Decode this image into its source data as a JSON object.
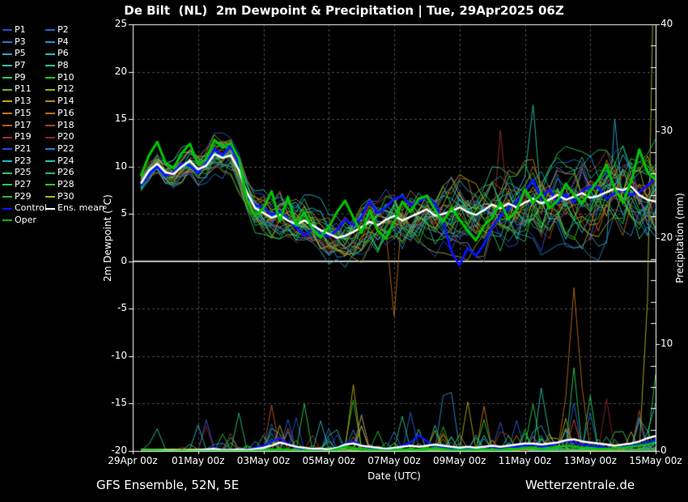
{
  "title": "De Bilt  (NL)  2m Dewpoint & Precipitation | Tue, 29Apr2025 06Z",
  "footer": {
    "left": "GFS Ensemble, 52N, 5E",
    "right": "Wetterzentrale.de"
  },
  "colors": {
    "background": "#000000",
    "grid": "#4d4d4d",
    "axis": "#ffffff",
    "zero_line": "#ffffff"
  },
  "legend": {
    "entries": [
      {
        "label": "P1",
        "color": "#2850d2"
      },
      {
        "label": "P2",
        "color": "#2862d8"
      },
      {
        "label": "P3",
        "color": "#2878d0"
      },
      {
        "label": "P4",
        "color": "#2890cc"
      },
      {
        "label": "P5",
        "color": "#28a8c8"
      },
      {
        "label": "P6",
        "color": "#28bcc0"
      },
      {
        "label": "P7",
        "color": "#28c4a8"
      },
      {
        "label": "P8",
        "color": "#28c888"
      },
      {
        "label": "P9",
        "color": "#28cc60"
      },
      {
        "label": "P10",
        "color": "#20c820"
      },
      {
        "label": "P11",
        "color": "#7ab428"
      },
      {
        "label": "P12",
        "color": "#aca818"
      },
      {
        "label": "P13",
        "color": "#c4a41c"
      },
      {
        "label": "P14",
        "color": "#c08618"
      },
      {
        "label": "P15",
        "color": "#c8781c"
      },
      {
        "label": "P16",
        "color": "#b86a14"
      },
      {
        "label": "P17",
        "color": "#c45420"
      },
      {
        "label": "P18",
        "color": "#a84428"
      },
      {
        "label": "P19",
        "color": "#9c3028"
      },
      {
        "label": "P20",
        "color": "#8c2424"
      },
      {
        "label": "P21",
        "color": "#2850d2"
      },
      {
        "label": "P22",
        "color": "#2884cc"
      },
      {
        "label": "P23",
        "color": "#28b4c4"
      },
      {
        "label": "P24",
        "color": "#28c49c"
      },
      {
        "label": "P25",
        "color": "#28c478"
      },
      {
        "label": "P26",
        "color": "#28b860"
      },
      {
        "label": "P27",
        "color": "#28cc48"
      },
      {
        "label": "P28",
        "color": "#24c828"
      },
      {
        "label": "P29",
        "color": "#30b430"
      },
      {
        "label": "P30",
        "color": "#b4b41e"
      },
      {
        "label": "Control",
        "color": "#0a14ff"
      },
      {
        "label": "Ens. mean",
        "color": "#ffffff"
      },
      {
        "label": "Oper",
        "color": "#00be00"
      }
    ]
  },
  "axes": {
    "left": {
      "label": "2m Dewpoint (°C)",
      "range": [
        -20,
        25
      ],
      "ticks": [
        25,
        20,
        15,
        10,
        5,
        0,
        -5,
        -10,
        -15,
        -20
      ]
    },
    "right": {
      "label": "Precipitation (mm)",
      "range": [
        0,
        40
      ],
      "minor_step": 2,
      "ticks": [
        40,
        30,
        20,
        10,
        0
      ]
    },
    "x": {
      "label": "Date (UTC)",
      "range_days": [
        0,
        16
      ],
      "ticks": [
        {
          "day": 0,
          "label": "29Apr 00z"
        },
        {
          "day": 2,
          "label": "01May 00z"
        },
        {
          "day": 4,
          "label": "03May 00z"
        },
        {
          "day": 6,
          "label": "05May 00z"
        },
        {
          "day": 8,
          "label": "07May 00z"
        },
        {
          "day": 10,
          "label": "09May 00z"
        },
        {
          "day": 12,
          "label": "11May 00z"
        },
        {
          "day": 14,
          "label": "13May 00z"
        },
        {
          "day": 16,
          "label": "15May 00z"
        }
      ]
    }
  },
  "chart_data": {
    "type": "line",
    "title": "De Bilt  (NL)  2m Dewpoint & Precipitation | Tue, 29Apr2025 06Z",
    "x_start_day": 0.25,
    "x_step_day": 0.25,
    "n_points": 64,
    "grid": "dashed",
    "legend_position": "top-left",
    "series": {
      "ens_mean": {
        "color": "#ffffff",
        "dewpoint": [
          8.2,
          9.6,
          10.3,
          9.4,
          9.2,
          10.0,
          10.6,
          9.7,
          10.1,
          11.3,
          10.9,
          11.2,
          9.6,
          7.2,
          5.6,
          5.1,
          4.6,
          4.9,
          4.3,
          3.9,
          4.3,
          3.8,
          3.3,
          2.9,
          2.5,
          2.7,
          3.1,
          3.6,
          4.2,
          3.8,
          4.4,
          4.8,
          4.3,
          4.7,
          5.1,
          5.5,
          4.8,
          5.0,
          5.3,
          5.7,
          5.2,
          4.9,
          5.4,
          6.0,
          5.6,
          6.1,
          5.7,
          6.2,
          6.6,
          6.1,
          6.5,
          7.0,
          6.5,
          6.8,
          7.2,
          6.7,
          6.9,
          7.3,
          7.7,
          7.5,
          7.9,
          7.0,
          6.5,
          6.3
        ],
        "precip": [
          0,
          0,
          0,
          0.05,
          0.05,
          0,
          0.05,
          0.1,
          0.15,
          0.2,
          0.1,
          0.1,
          0.15,
          0.1,
          0.2,
          0.3,
          0.5,
          0.8,
          0.6,
          0.4,
          0.3,
          0.2,
          0.2,
          0.15,
          0.3,
          0.6,
          0.7,
          0.5,
          0.4,
          0.3,
          0.2,
          0.3,
          0.4,
          0.5,
          0.4,
          0.5,
          0.6,
          0.5,
          0.4,
          0.3,
          0.4,
          0.3,
          0.4,
          0.5,
          0.4,
          0.5,
          0.6,
          0.7,
          0.7,
          0.6,
          0.7,
          0.8,
          1.0,
          1.1,
          0.9,
          0.8,
          0.7,
          0.6,
          0.5,
          0.6,
          0.7,
          0.9,
          1.2,
          1.4
        ]
      },
      "control": {
        "color": "#0a14ff",
        "dewpoint": [
          8.0,
          9.2,
          10.0,
          9.0,
          9.4,
          10.3,
          10.1,
          9.3,
          10.4,
          11.8,
          11.2,
          12.2,
          10.2,
          6.8,
          5.9,
          5.7,
          4.9,
          5.3,
          4.4,
          3.6,
          2.7,
          3.4,
          2.9,
          2.6,
          3.3,
          4.4,
          3.8,
          4.6,
          6.4,
          5.1,
          5.7,
          6.6,
          6.9,
          5.9,
          6.3,
          6.8,
          6.1,
          4.2,
          1.0,
          -0.4,
          1.4,
          0.6,
          1.8,
          3.6,
          4.8,
          5.6,
          6.3,
          7.4,
          8.6,
          6.6,
          7.6,
          6.1,
          7.1,
          6.2,
          7.4,
          7.9,
          7.8,
          6.6,
          7.2,
          7.5,
          7.0,
          7.3,
          8.0,
          8.8
        ],
        "precip": [
          0,
          0,
          0,
          0,
          0,
          0,
          0,
          0,
          0.1,
          0.3,
          0.1,
          0,
          0.2,
          0.1,
          0.3,
          0.5,
          0.9,
          1.2,
          0.7,
          0.3,
          0.2,
          0.1,
          0.1,
          0.1,
          0.3,
          0.7,
          0.9,
          0.5,
          0.3,
          0.2,
          0.1,
          0.2,
          0.5,
          0.8,
          1.5,
          0.9,
          0.4,
          0.3,
          0.2,
          0.2,
          0.3,
          0.2,
          0.3,
          0.4,
          0.2,
          0.3,
          0.4,
          0.5,
          0.6,
          0.4,
          0.5,
          0.7,
          1.0,
          0.8,
          0.6,
          0.5,
          0.4,
          0.3,
          0.3,
          0.4,
          0.5,
          0.6,
          0.8,
          1.0
        ]
      },
      "oper": {
        "color": "#00c800",
        "dewpoint": [
          9.0,
          11.2,
          12.6,
          10.4,
          9.8,
          11.4,
          12.4,
          10.2,
          10.8,
          12.8,
          12.0,
          12.5,
          10.8,
          6.4,
          4.8,
          5.6,
          7.4,
          4.2,
          6.8,
          3.8,
          5.2,
          3.4,
          2.6,
          3.6,
          5.2,
          6.4,
          4.6,
          3.0,
          5.4,
          3.2,
          2.4,
          4.2,
          6.3,
          5.2,
          6.6,
          6.9,
          5.4,
          4.2,
          5.6,
          4.4,
          3.2,
          2.2,
          3.8,
          4.6,
          6.2,
          4.4,
          5.4,
          7.6,
          6.2,
          7.2,
          5.6,
          6.4,
          8.2,
          7.0,
          6.2,
          7.4,
          8.6,
          10.2,
          7.6,
          6.2,
          8.4,
          11.8,
          9.4,
          8.6
        ],
        "precip": [
          0,
          0,
          0,
          0,
          0,
          0,
          0,
          0,
          0,
          0,
          0,
          0,
          0,
          0,
          0,
          0,
          0.1,
          0.2,
          0.1,
          0,
          0.1,
          0,
          0,
          0,
          0.2,
          0.4,
          0.3,
          0.1,
          0.1,
          0.1,
          0,
          0.1,
          0.1,
          0.2,
          0.1,
          0.2,
          0.3,
          0.2,
          0.1,
          0.1,
          0.1,
          0.1,
          0.2,
          0.1,
          0.1,
          0.2,
          0.2,
          0.3,
          0.3,
          0.2,
          0.3,
          0.4,
          0.5,
          0.4,
          0.3,
          0.3,
          0.2,
          0.2,
          0.3,
          0.3,
          0.4,
          0.5,
          0.6,
          0.8
        ]
      }
    },
    "members": {
      "count": 30,
      "colors": [
        "#2850d2",
        "#2862d8",
        "#2878d0",
        "#2890cc",
        "#28a8c8",
        "#28bcc0",
        "#28c4a8",
        "#28c888",
        "#28cc60",
        "#20c820",
        "#7ab428",
        "#aca818",
        "#c4a41c",
        "#c08618",
        "#c8781c",
        "#b86a14",
        "#c45420",
        "#a84428",
        "#9c3028",
        "#8c2424",
        "#2850d2",
        "#2884cc",
        "#28b4c4",
        "#28c49c",
        "#28c478",
        "#28b860",
        "#28cc48",
        "#24c828",
        "#30b430",
        "#b4b41e"
      ],
      "seed_base": 42,
      "seed_step": 101,
      "dew_envelope_min": [
        6.5,
        7.5,
        8.0,
        5.5,
        1.5,
        0.5,
        -0.5,
        -1.0,
        -1.5,
        -2.0,
        -1.5,
        -1.0,
        -0.5,
        0.0,
        0.5,
        -1.0,
        -3.0
      ],
      "dew_envelope_max": [
        11.5,
        13.0,
        13.5,
        13.8,
        8.5,
        7.5,
        7.5,
        8.5,
        12.5,
        13.0,
        13.5,
        14.0,
        16.0,
        14.5,
        15.5,
        16.0,
        14.5
      ],
      "precip_activity": [
        0.02,
        0.02,
        0.06,
        0.1,
        0.12,
        0.08,
        0.15,
        0.12,
        0.06,
        0.1,
        0.1,
        0.08,
        0.15,
        0.18,
        0.15,
        0.15,
        0.2
      ]
    },
    "features": {
      "dewpoint": [
        {
          "m": 15,
          "day": 8.0,
          "value": -5.8
        },
        {
          "m": 6,
          "day": 12.25,
          "value": 16.5
        },
        {
          "m": 4,
          "day": 14.75,
          "value": 15.0
        },
        {
          "m": 18,
          "day": 11.25,
          "value": 13.8
        }
      ],
      "precip": [
        {
          "m": 12,
          "day": 4.5,
          "value": 2.4
        },
        {
          "m": 16,
          "day": 4.75,
          "value": 2.1
        },
        {
          "m": 3,
          "day": 4.75,
          "value": 1.8
        },
        {
          "m": 8,
          "day": 4.5,
          "value": 1.6
        },
        {
          "m": 12,
          "day": 6.75,
          "value": 6.2
        },
        {
          "m": 9,
          "day": 6.75,
          "value": 4.8
        },
        {
          "m": 5,
          "day": 7.0,
          "value": 3.4
        },
        {
          "m": 2,
          "day": 7.0,
          "value": 2.4
        },
        {
          "m": 3,
          "day": 9.5,
          "value": 5.2
        },
        {
          "m": 3,
          "day": 9.75,
          "value": 5.5
        },
        {
          "m": 11,
          "day": 10.25,
          "value": 4.6
        },
        {
          "m": 14,
          "day": 10.75,
          "value": 4.2
        },
        {
          "m": 6,
          "day": 12.5,
          "value": 5.9
        },
        {
          "m": 26,
          "day": 12.25,
          "value": 4.4
        },
        {
          "m": 15,
          "day": 13.25,
          "value": 5.0
        },
        {
          "m": 15,
          "day": 13.5,
          "value": 15.3
        },
        {
          "m": 15,
          "day": 13.75,
          "value": 6.0
        },
        {
          "m": 8,
          "day": 13.5,
          "value": 7.8
        },
        {
          "m": 8,
          "day": 14.0,
          "value": 5.2
        },
        {
          "m": 19,
          "day": 14.5,
          "value": 4.9
        },
        {
          "m": 1,
          "day": 15.5,
          "value": 3.2
        },
        {
          "m": 29,
          "day": 15.75,
          "value": 14.0
        },
        {
          "m": 29,
          "day": 16.0,
          "value": 55.0
        },
        {
          "m": 5,
          "day": 16.0,
          "value": 4.5
        },
        {
          "m": 26,
          "day": 16.0,
          "value": 7.2
        }
      ]
    }
  }
}
